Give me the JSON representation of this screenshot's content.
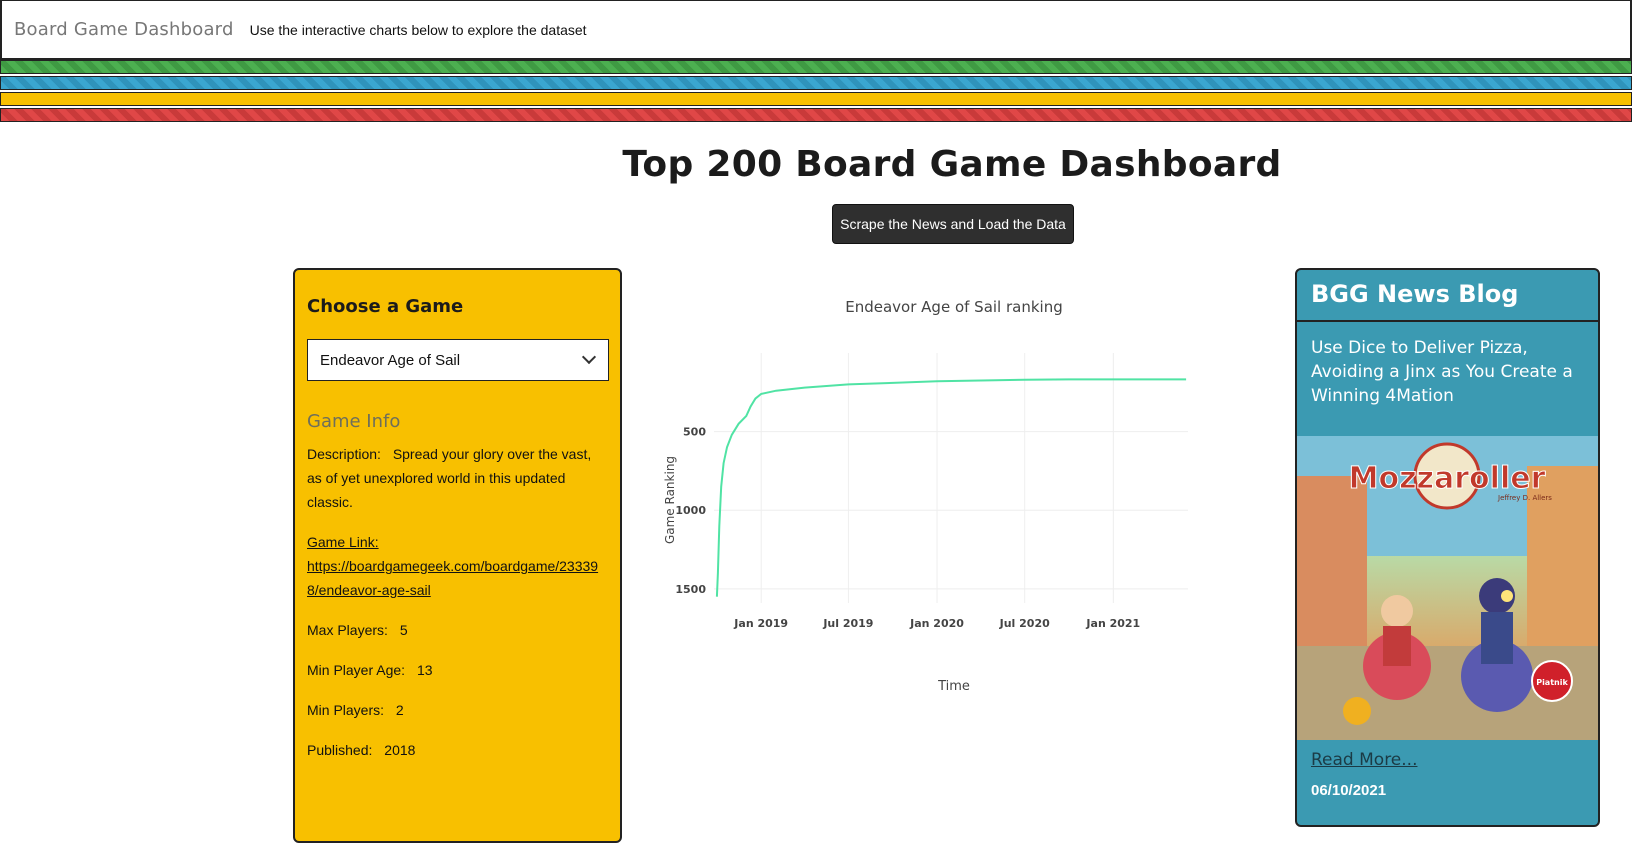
{
  "navbar": {
    "brand": "Board Game Dashboard",
    "subtitle": "Use the interactive charts below to explore the dataset"
  },
  "page": {
    "title": "Top 200 Board Game Dashboard",
    "scrape_button": "Scrape the News and Load the Data"
  },
  "game_panel": {
    "heading": "Choose a Game",
    "selected_game": "Endeavor Age of Sail",
    "info_heading": "Game Info",
    "description_label": "Description:",
    "description": "Spread your glory over the vast, as of yet unexplored world in this updated classic.",
    "link_label": "Game Link:",
    "link": "https://boardgamegeek.com/boardgame/233398/endeavor-age-sail",
    "max_players_label": "Max Players:",
    "max_players": "5",
    "min_age_label": "Min Player Age:",
    "min_age": "13",
    "min_players_label": "Min Players:",
    "min_players": "2",
    "published_label": "Published:",
    "published": "2018"
  },
  "news": {
    "heading": "BGG News Blog",
    "title": "Use Dice to Deliver Pizza, Avoiding a Jinx as You Create a Winning 4Mation",
    "image_title": "Mozzaroller",
    "image_author": "Jeffrey D. Allers",
    "image_badge": "Piatnik",
    "read_more": "Read More...",
    "date": "06/10/2021"
  },
  "colors": {
    "green": "#4caf50",
    "blue": "#3aa6d0",
    "yellow": "#f8c000",
    "red": "#e04747",
    "panel_blue": "#3b9ab2",
    "line": "#50e3a4"
  },
  "chart_data": {
    "type": "line",
    "title": "Endeavor Age of Sail ranking",
    "xlabel": "Time",
    "ylabel": "Game Ranking",
    "y_reversed": true,
    "ylim": [
      1590,
      0
    ],
    "y_ticks": [
      500,
      1000,
      1500
    ],
    "x_ticks": [
      "Jan 2019",
      "Jul 2019",
      "Jan 2020",
      "Jul 2020",
      "Jan 2021"
    ],
    "grid": true,
    "series": [
      {
        "x": [
          "2018-10-01",
          "2018-10-03",
          "2018-10-06",
          "2018-10-10",
          "2018-10-15",
          "2018-10-22",
          "2018-11-01",
          "2018-11-15",
          "2018-12-01",
          "2018-12-10",
          "2018-12-20",
          "2019-01-01",
          "2019-02-01",
          "2019-04-01",
          "2019-07-01",
          "2019-10-01",
          "2020-01-01",
          "2020-04-01",
          "2020-07-01",
          "2020-10-01",
          "2021-01-01",
          "2021-04-01",
          "2021-06-01"
        ],
        "y": [
          1550,
          1400,
          1100,
          850,
          700,
          600,
          520,
          450,
          400,
          340,
          290,
          260,
          240,
          220,
          200,
          190,
          180,
          175,
          170,
          168,
          168,
          168,
          168
        ]
      }
    ]
  }
}
